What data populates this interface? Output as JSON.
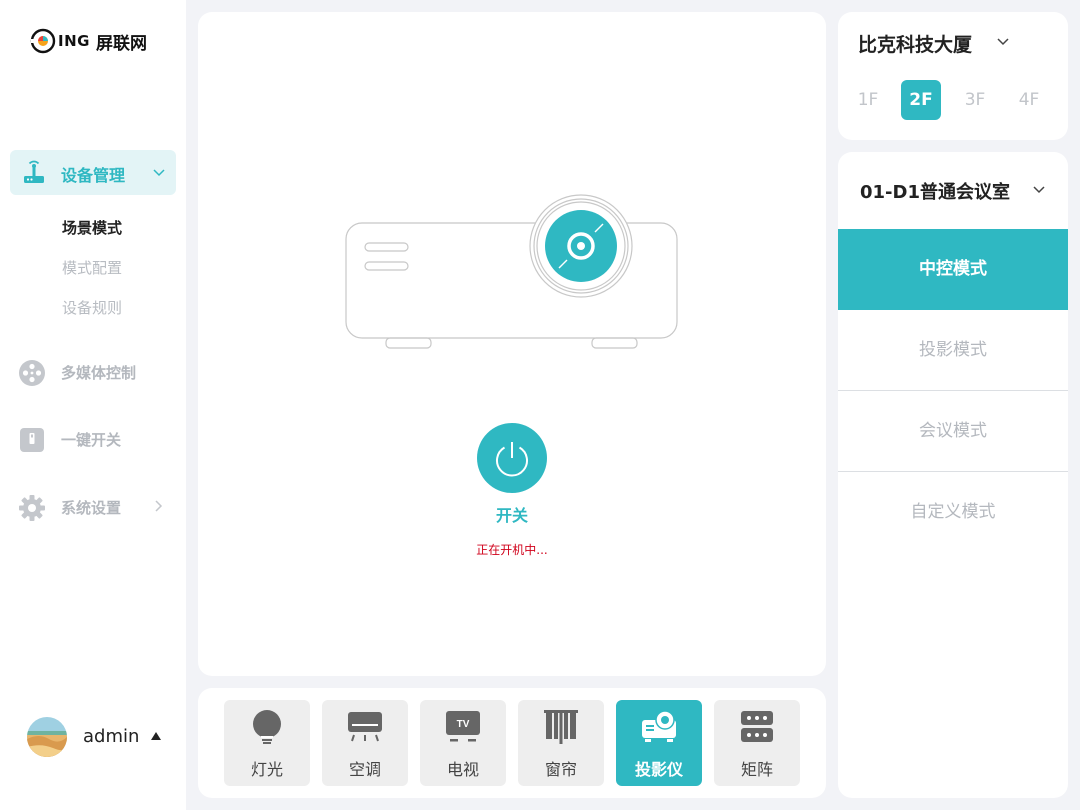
{
  "brand": {
    "logo_text": "ING",
    "logo_cn": "屏联网"
  },
  "sidebar": {
    "active": {
      "label": "设备管理",
      "icon": "router-icon"
    },
    "subitems": [
      {
        "label": "场景模式",
        "current": true
      },
      {
        "label": "模式配置",
        "current": false
      },
      {
        "label": "设备规则",
        "current": false
      }
    ],
    "items": [
      {
        "label": "多媒体控制",
        "icon": "film-reel-icon"
      },
      {
        "label": "一键开关",
        "icon": "switch-icon"
      },
      {
        "label": "系统设置",
        "icon": "gear-icon"
      }
    ],
    "user": {
      "name": "admin"
    }
  },
  "device_panel": {
    "power_label": "开关",
    "status": "正在开机中..."
  },
  "devices": [
    {
      "label": "灯光",
      "icon": "bulb-icon",
      "active": false
    },
    {
      "label": "空调",
      "icon": "air-conditioner-icon",
      "active": false
    },
    {
      "label": "电视",
      "icon": "tv-icon",
      "active": false
    },
    {
      "label": "窗帘",
      "icon": "curtain-icon",
      "active": false
    },
    {
      "label": "投影仪",
      "icon": "projector-icon",
      "active": true
    },
    {
      "label": "矩阵",
      "icon": "matrix-icon",
      "active": false
    }
  ],
  "building": {
    "title": "比克科技大厦",
    "floors": [
      "1F",
      "2F",
      "3F",
      "4F"
    ],
    "active_floor": "2F"
  },
  "room": {
    "title": "01-D1普通会议室",
    "modes": [
      "中控模式",
      "投影模式",
      "会议模式",
      "自定义模式"
    ],
    "active_mode": "中控模式"
  },
  "colors": {
    "accent": "#2fb8c2",
    "status": "#d0021b",
    "muted": "#b4b8be"
  }
}
